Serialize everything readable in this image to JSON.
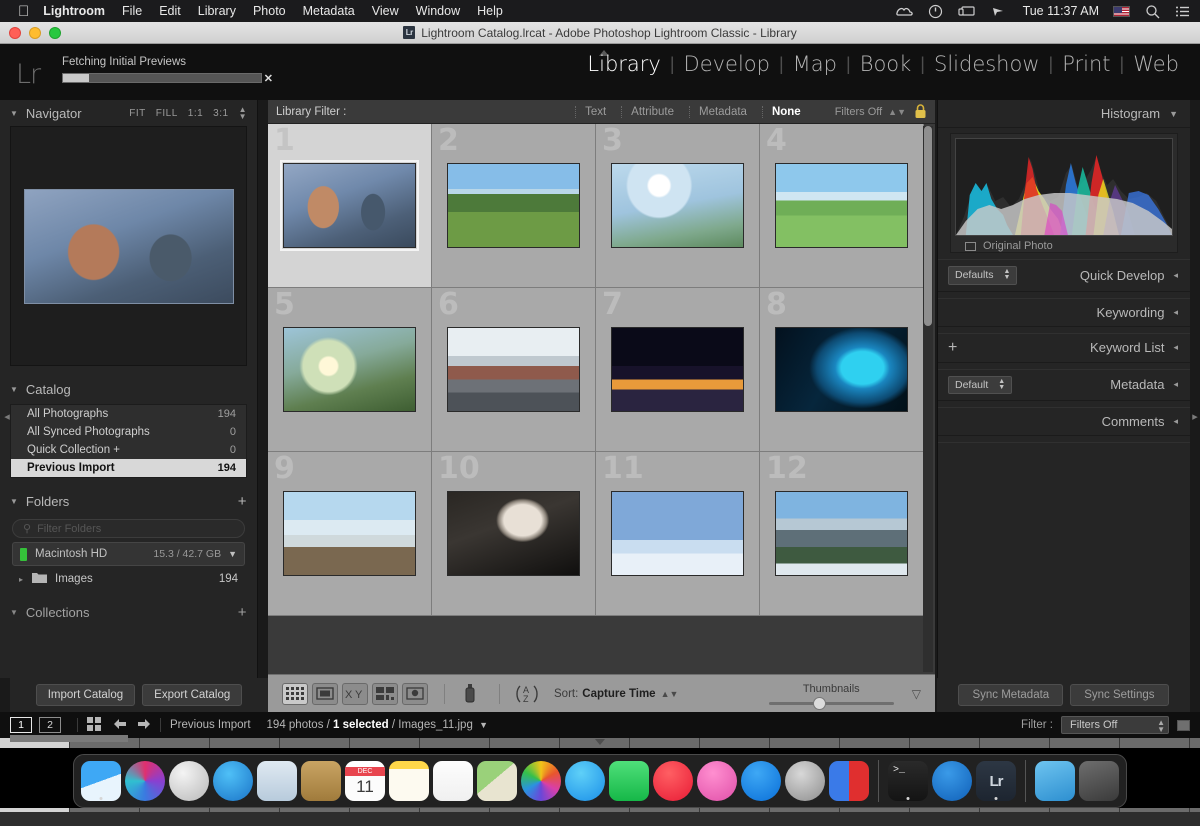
{
  "menubar": {
    "apple_icon": "apple-icon",
    "items": [
      "Lightroom",
      "File",
      "Edit",
      "Library",
      "Photo",
      "Metadata",
      "View",
      "Window",
      "Help"
    ],
    "status_icons": [
      "creative-cloud-icon",
      "power-icon",
      "screen-mirroring-icon",
      "shortcuts-icon"
    ],
    "clock": "Tue 11:37 AM",
    "flag": "us-flag-icon",
    "search_icon": "search-icon",
    "notification_icon": "notification-center-icon"
  },
  "window": {
    "title": "Lightroom Catalog.lrcat - Adobe Photoshop Lightroom Classic - Library",
    "app_badge": "Lr"
  },
  "header": {
    "logo": "Lr",
    "progress_label": "Fetching Initial Previews",
    "progress_percent": 13,
    "cancel_icon": "close-icon",
    "modules": [
      "Library",
      "Develop",
      "Map",
      "Book",
      "Slideshow",
      "Print",
      "Web"
    ],
    "active_module": "Library"
  },
  "left_panel": {
    "navigator": {
      "title": "Navigator",
      "zoom_options": [
        "FIT",
        "FILL",
        "1:1",
        "3:1"
      ]
    },
    "catalog": {
      "title": "Catalog",
      "items": [
        {
          "label": "All Photographs",
          "count": "194",
          "selected": false
        },
        {
          "label": "All Synced Photographs",
          "count": "0",
          "selected": false
        },
        {
          "label": "Quick Collection  +",
          "count": "0",
          "selected": false
        },
        {
          "label": "Previous Import",
          "count": "194",
          "selected": true
        }
      ]
    },
    "folders": {
      "title": "Folders",
      "add_icon": "plus-icon",
      "filter_placeholder": "Filter Folders",
      "volume": {
        "name": "Macintosh HD",
        "space": "15.3 / 42.7 GB"
      },
      "folder": {
        "name": "Images",
        "count": "194"
      }
    },
    "collections": {
      "title": "Collections"
    },
    "buttons": [
      "Import Catalog",
      "Export Catalog"
    ]
  },
  "filter_bar": {
    "label": "Library Filter :",
    "options": [
      "Text",
      "Attribute",
      "Metadata",
      "None"
    ],
    "active": "None",
    "filters_off": "Filters Off",
    "lock_icon": "lock-icon"
  },
  "grid": {
    "cells": [
      {
        "num": "1",
        "name": "fantasy-warrior",
        "selected": true
      },
      {
        "num": "2",
        "name": "alpine-barn",
        "selected": false
      },
      {
        "num": "3",
        "name": "blossom-sky",
        "selected": false
      },
      {
        "num": "4",
        "name": "lake-meadow",
        "selected": false
      },
      {
        "num": "5",
        "name": "sunrise-forest",
        "selected": false
      },
      {
        "num": "6",
        "name": "city-railyard",
        "selected": false
      },
      {
        "num": "7",
        "name": "night-skyline",
        "selected": false
      },
      {
        "num": "8",
        "name": "blue-feathers",
        "selected": false
      },
      {
        "num": "9",
        "name": "coastal-mist",
        "selected": false
      },
      {
        "num": "10",
        "name": "bw-portrait",
        "selected": false
      },
      {
        "num": "11",
        "name": "tiger-snow",
        "selected": false
      },
      {
        "num": "12",
        "name": "mountain-peaks",
        "selected": false
      }
    ]
  },
  "toolbar": {
    "view_icons": [
      "grid-view-icon",
      "loupe-view-icon",
      "compare-view-icon",
      "survey-view-icon",
      "people-view-icon"
    ],
    "painter_icon": "spray-can-icon",
    "sort_icon": "az-sort-icon",
    "sort_label": "Sort:",
    "sort_value": "Capture Time",
    "thumbnails_label": "Thumbnails",
    "thumbnail_size": 36,
    "toolbar_toggle_icon": "chevron-down-icon"
  },
  "right_panel": {
    "histogram": {
      "title": "Histogram",
      "original_photo": "Original Photo"
    },
    "sections": [
      {
        "title": "Quick Develop",
        "preset": "Defaults"
      },
      {
        "title": "Keywording",
        "preset": null
      },
      {
        "title": "Keyword List",
        "preset": null,
        "plus": "+"
      },
      {
        "title": "Metadata",
        "preset": "Default"
      },
      {
        "title": "Comments",
        "preset": null
      }
    ],
    "buttons": [
      "Sync Metadata",
      "Sync Settings"
    ]
  },
  "filmstrip_bar": {
    "page_buttons": [
      "1",
      "2"
    ],
    "grid_icon": "grid-icon",
    "back_icon": "arrow-left-icon",
    "forward_icon": "arrow-right-icon",
    "source": "Previous Import",
    "count_text": "194 photos /",
    "selected_text": "1 selected",
    "filename": "/ Images_11.jpg",
    "dropdown_icon": "chevron-down-icon",
    "filter_label": "Filter :",
    "filter_value": "Filters Off"
  },
  "dock": {
    "items": [
      {
        "name": "finder",
        "label": ""
      },
      {
        "name": "siri",
        "label": ""
      },
      {
        "name": "launchpad",
        "label": ""
      },
      {
        "name": "safari",
        "label": ""
      },
      {
        "name": "mail",
        "label": ""
      },
      {
        "name": "contacts",
        "label": ""
      },
      {
        "name": "calendar",
        "label": "DEC 11"
      },
      {
        "name": "notes",
        "label": ""
      },
      {
        "name": "reminders",
        "label": ""
      },
      {
        "name": "maps",
        "label": ""
      },
      {
        "name": "photos",
        "label": ""
      },
      {
        "name": "messages",
        "label": ""
      },
      {
        "name": "facetime",
        "label": ""
      },
      {
        "name": "news",
        "label": ""
      },
      {
        "name": "itunes",
        "label": ""
      },
      {
        "name": "app-store",
        "label": ""
      },
      {
        "name": "system-preferences",
        "label": ""
      },
      {
        "name": "magnet",
        "label": ""
      },
      {
        "name": "terminal",
        "label": ""
      },
      {
        "name": "1password",
        "label": ""
      },
      {
        "name": "lightroom",
        "label": "Lr"
      },
      {
        "name": "downloads",
        "label": ""
      },
      {
        "name": "trash",
        "label": ""
      }
    ]
  },
  "colors": {
    "panel_bg": "#252525",
    "grid_bg": "#3a3a3a",
    "cell_bg": "#a9a9a9",
    "cell_selected_bg": "#d4d4d4",
    "toolbar_bg": "#9a9a9a",
    "accent_text": "#ffffff"
  }
}
